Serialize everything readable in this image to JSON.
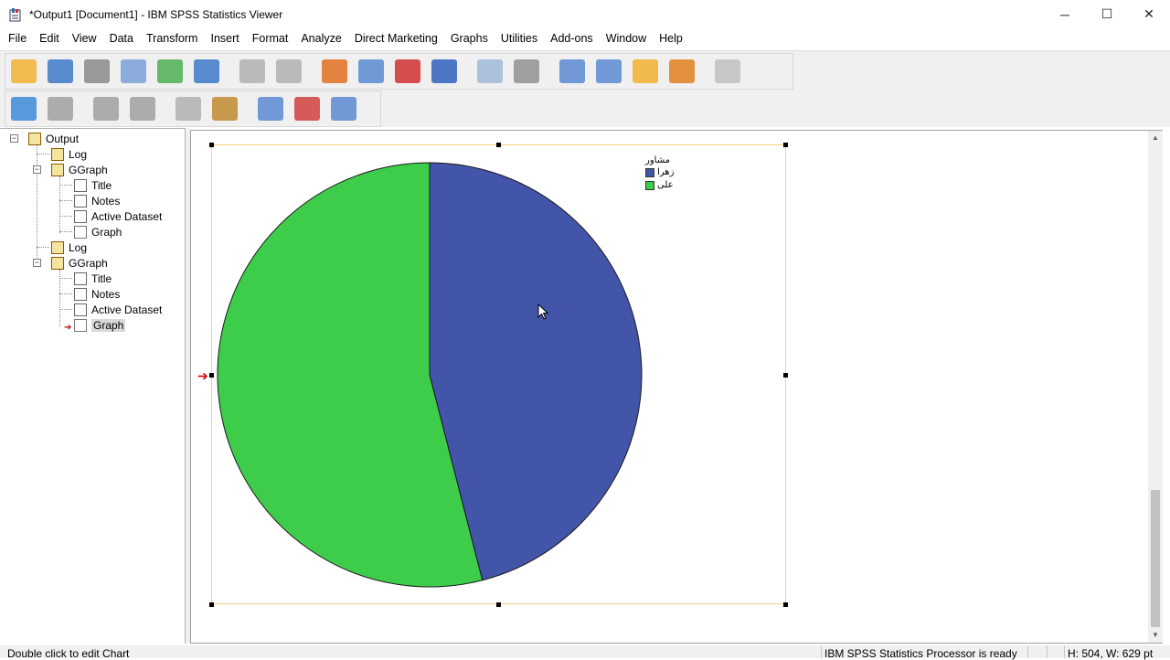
{
  "window": {
    "title": "*Output1 [Document1] - IBM SPSS Statistics Viewer",
    "minimize": "─",
    "maximize": "☐",
    "close": "✕"
  },
  "menu": [
    "File",
    "Edit",
    "View",
    "Data",
    "Transform",
    "Insert",
    "Format",
    "Analyze",
    "Direct Marketing",
    "Graphs",
    "Utilities",
    "Add-ons",
    "Window",
    "Help"
  ],
  "toolbar1": [
    {
      "name": "open-icon",
      "color": "#f2b233"
    },
    {
      "name": "save-icon",
      "color": "#3d78c8"
    },
    {
      "name": "print-icon",
      "color": "#8a8a8a"
    },
    {
      "name": "print-preview-icon",
      "color": "#7aa0d8"
    },
    {
      "name": "export-icon",
      "color": "#4caf50"
    },
    {
      "name": "recall-dialog-icon",
      "color": "#3d78c8"
    },
    {
      "name": "undo-icon",
      "color": "#b0b0b0"
    },
    {
      "name": "redo-icon",
      "color": "#b0b0b0"
    },
    {
      "name": "goto-data-icon",
      "color": "#e07020"
    },
    {
      "name": "goto-case-icon",
      "color": "#5a8ad0"
    },
    {
      "name": "insert-cases-icon",
      "color": "#d03030"
    },
    {
      "name": "variables-icon",
      "color": "#3060c0"
    },
    {
      "name": "select-cases-icon",
      "color": "#a0b8d8"
    },
    {
      "name": "weight-cases-icon",
      "color": "#909090"
    },
    {
      "name": "split-file-icon",
      "color": "#5a8ad0"
    },
    {
      "name": "value-labels-icon",
      "color": "#5a8ad0"
    },
    {
      "name": "use-sets-icon",
      "color": "#f0b030"
    },
    {
      "name": "show-all-icon",
      "color": "#e08020"
    },
    {
      "name": "spell-icon",
      "color": "#c0c0c0"
    }
  ],
  "toolbar2": [
    {
      "name": "back-icon",
      "color": "#3d8ad8"
    },
    {
      "name": "forward-icon",
      "color": "#a0a0a0"
    },
    {
      "name": "expand-icon",
      "color": "#a0a0a0"
    },
    {
      "name": "collapse-icon",
      "color": "#a0a0a0"
    },
    {
      "name": "show-icon",
      "color": "#b0b0b0"
    },
    {
      "name": "hide-icon",
      "color": "#c08a30"
    },
    {
      "name": "insert-heading-icon",
      "color": "#5a8ad0"
    },
    {
      "name": "insert-title-icon",
      "color": "#d04040"
    },
    {
      "name": "insert-text-icon",
      "color": "#5a8ad0"
    }
  ],
  "outline": {
    "root": "Output",
    "items": [
      {
        "label": "Log",
        "type": "book"
      },
      {
        "label": "GGraph",
        "type": "book"
      },
      {
        "label": "Title",
        "type": "doc"
      },
      {
        "label": "Notes",
        "type": "doc"
      },
      {
        "label": "Active Dataset",
        "type": "doc"
      },
      {
        "label": "Graph",
        "type": "graph"
      },
      {
        "label": "Log",
        "type": "book"
      },
      {
        "label": "GGraph",
        "type": "book"
      },
      {
        "label": "Title",
        "type": "doc"
      },
      {
        "label": "Notes",
        "type": "doc"
      },
      {
        "label": "Active Dataset",
        "type": "doc"
      },
      {
        "label": "Graph",
        "type": "graph"
      }
    ]
  },
  "legend": {
    "title": "مشاور",
    "items": [
      {
        "label": "زهرا",
        "color": "#4355a8"
      },
      {
        "label": "علی",
        "color": "#3ecd4a"
      }
    ]
  },
  "chart_data": {
    "type": "pie",
    "categories": [
      "زهرا",
      "علی"
    ],
    "values": [
      46,
      54
    ],
    "colors": [
      "#4355a8",
      "#3ecd4a"
    ],
    "legend_title": "مشاور",
    "legend_position": "top-right"
  },
  "status": {
    "left": "Double click to edit Chart",
    "middle": "IBM SPSS Statistics Processor is ready",
    "right": "H: 504, W: 629 pt"
  }
}
